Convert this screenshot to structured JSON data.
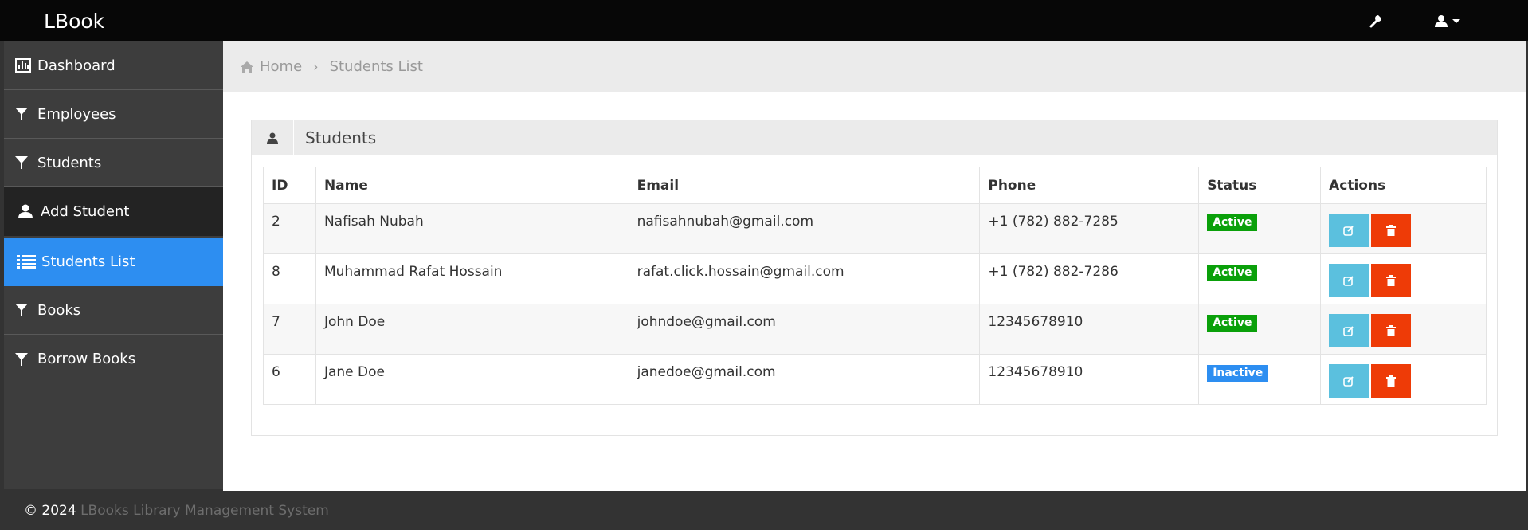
{
  "app": {
    "brand": "LBook"
  },
  "sidebar": {
    "items": [
      {
        "label": "Dashboard",
        "icon": "bar-chart-icon"
      },
      {
        "label": "Employees",
        "icon": "filter-icon"
      },
      {
        "label": "Students",
        "icon": "filter-icon"
      },
      {
        "label": "Add Student",
        "icon": "user-icon"
      },
      {
        "label": "Students List",
        "icon": "list-icon"
      },
      {
        "label": "Books",
        "icon": "filter-icon"
      },
      {
        "label": "Borrow Books",
        "icon": "filter-icon"
      }
    ]
  },
  "breadcrumb": {
    "home": "Home",
    "current": "Students List"
  },
  "panel": {
    "title": "Students"
  },
  "table": {
    "headers": [
      "ID",
      "Name",
      "Email",
      "Phone",
      "Status",
      "Actions"
    ],
    "rows": [
      {
        "id": "2",
        "name": "Nafisah Nubah",
        "email": "nafisahnubah@gmail.com",
        "phone": "+1 (782) 882-7285",
        "status": "Active"
      },
      {
        "id": "8",
        "name": "Muhammad Rafat Hossain",
        "email": "rafat.click.hossain@gmail.com",
        "phone": "+1 (782) 882-7286",
        "status": "Active"
      },
      {
        "id": "7",
        "name": "John Doe",
        "email": "johndoe@gmail.com",
        "phone": "12345678910",
        "status": "Active"
      },
      {
        "id": "6",
        "name": "Jane Doe",
        "email": "janedoe@gmail.com",
        "phone": "12345678910",
        "status": "Inactive"
      }
    ]
  },
  "footer": {
    "copyright": "© 2024",
    "system_name": "LBooks Library Management System"
  },
  "colors": {
    "accent": "#2d8ef1",
    "active_badge": "#0aa00a",
    "edit_button": "#5bc0de",
    "delete_button": "#ee3b07"
  }
}
